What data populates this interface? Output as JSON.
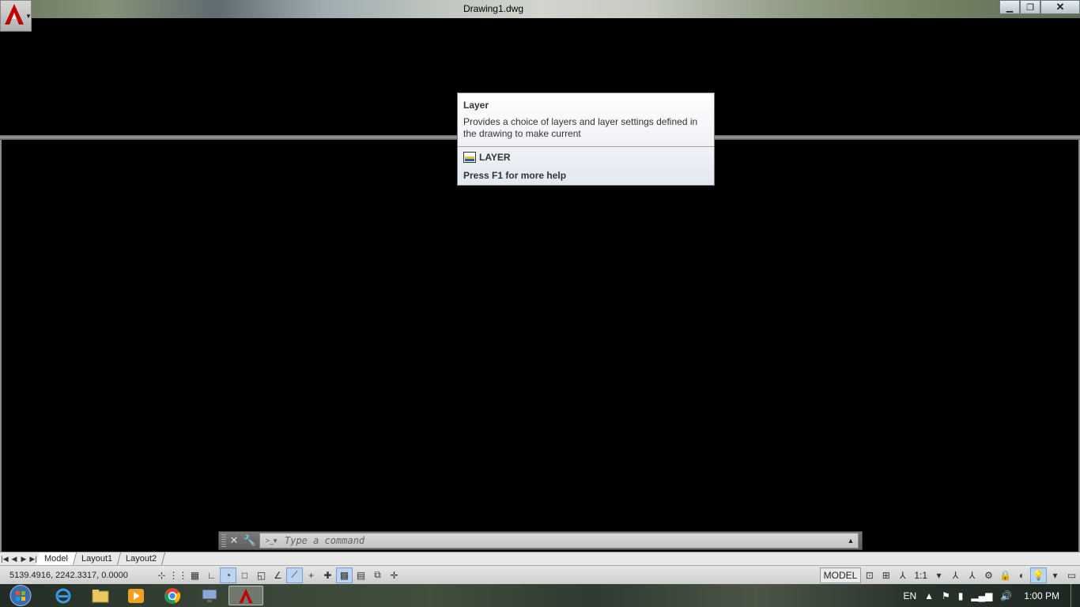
{
  "window": {
    "title": "Drawing1.dwg",
    "minimize_icon": "minimize-icon",
    "restore_icon": "restore-icon",
    "close_icon": "close-icon",
    "app_icon": "autocad-logo-icon",
    "accent_color": "#c00000"
  },
  "tooltip": {
    "title": "Layer",
    "description": "Provides a choice of layers and layer settings defined in the drawing to make current",
    "command": "LAYER",
    "help": "Press F1 for more help"
  },
  "command_line": {
    "placeholder": "Type a command",
    "close_icon": "close-icon",
    "customize_icon": "wrench-icon",
    "prompt_icon": "command-prompt-icon",
    "history_icon": "caret-up-icon"
  },
  "tabs": {
    "items": [
      {
        "label": "Model",
        "active": true
      },
      {
        "label": "Layout1",
        "active": false
      },
      {
        "label": "Layout2",
        "active": false
      }
    ]
  },
  "status": {
    "coords": "5139.4916, 2242.3317, 0.0000",
    "model": "MODEL",
    "scale": "1:1",
    "toggles": [
      {
        "icon": "infer-constraints-icon",
        "on": false
      },
      {
        "icon": "snap-mode-icon",
        "on": false
      },
      {
        "icon": "grid-display-icon",
        "on": false
      },
      {
        "icon": "ortho-mode-icon",
        "on": false
      },
      {
        "icon": "polar-tracking-icon",
        "on": true
      },
      {
        "icon": "object-snap-icon",
        "on": false
      },
      {
        "icon": "3d-object-snap-icon",
        "on": false
      },
      {
        "icon": "object-snap-tracking-icon",
        "on": false
      },
      {
        "icon": "dynamic-ucs-icon",
        "on": true
      },
      {
        "icon": "dynamic-input-icon",
        "on": false
      },
      {
        "icon": "lineweight-icon",
        "on": false
      },
      {
        "icon": "transparency-icon",
        "on": true
      },
      {
        "icon": "quick-properties-icon",
        "on": false
      },
      {
        "icon": "selection-cycling-icon",
        "on": false
      },
      {
        "icon": "annotation-monitor-icon",
        "on": false
      }
    ]
  },
  "taskbar": {
    "language": "EN",
    "time": "1:00 PM"
  }
}
